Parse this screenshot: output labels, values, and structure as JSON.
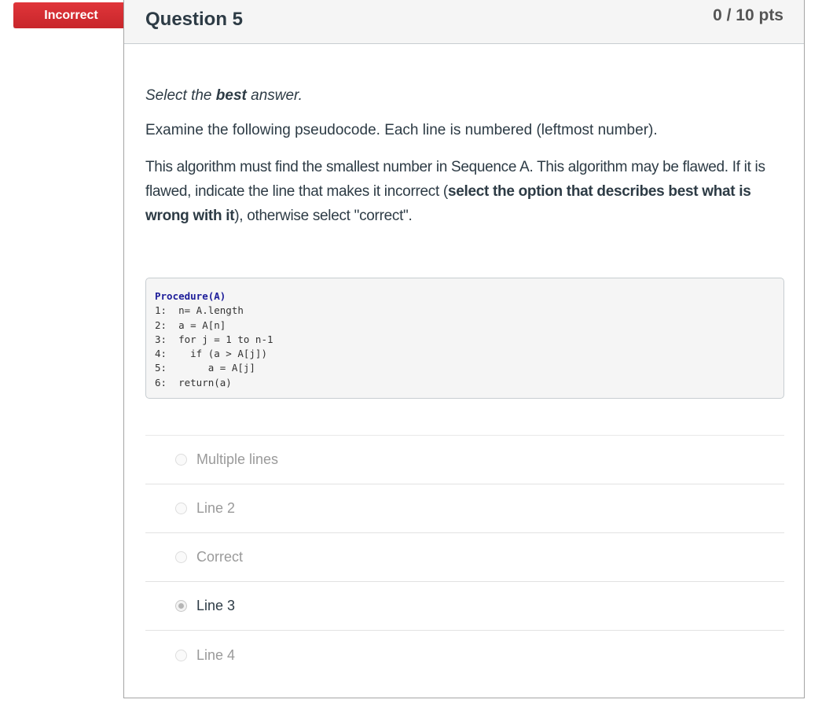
{
  "flag": {
    "label": "Incorrect",
    "color": "#d42f34"
  },
  "question": {
    "title": "Question 5",
    "points": "0 / 10 pts",
    "instruction_pre": "Select the ",
    "instruction_bold": "best",
    "instruction_post": " answer.",
    "intro": "Examine the following pseudocode. Each line is numbered (leftmost number).",
    "desc_1": "This algorithm must find the smallest number in Sequence A. This algorithm may be flawed. If it is flawed, indicate the line that makes it incorrect (",
    "desc_bold": "select the option that describes best what is wrong with it",
    "desc_2": "), otherwise select \"correct\".",
    "code": {
      "header": "Procedure(A)",
      "lines": [
        "1:  n= A.length",
        "2:  a = A[n]",
        "3:  for j = 1 to n-1",
        "4:    if (a > A[j])",
        "5:       a = A[j]",
        "6:  return(a)"
      ]
    },
    "answers": [
      {
        "label": "Multiple lines",
        "selected": false
      },
      {
        "label": "Line 2",
        "selected": false
      },
      {
        "label": "Correct",
        "selected": false
      },
      {
        "label": "Line 3",
        "selected": true
      },
      {
        "label": "Line 4",
        "selected": false
      }
    ]
  }
}
